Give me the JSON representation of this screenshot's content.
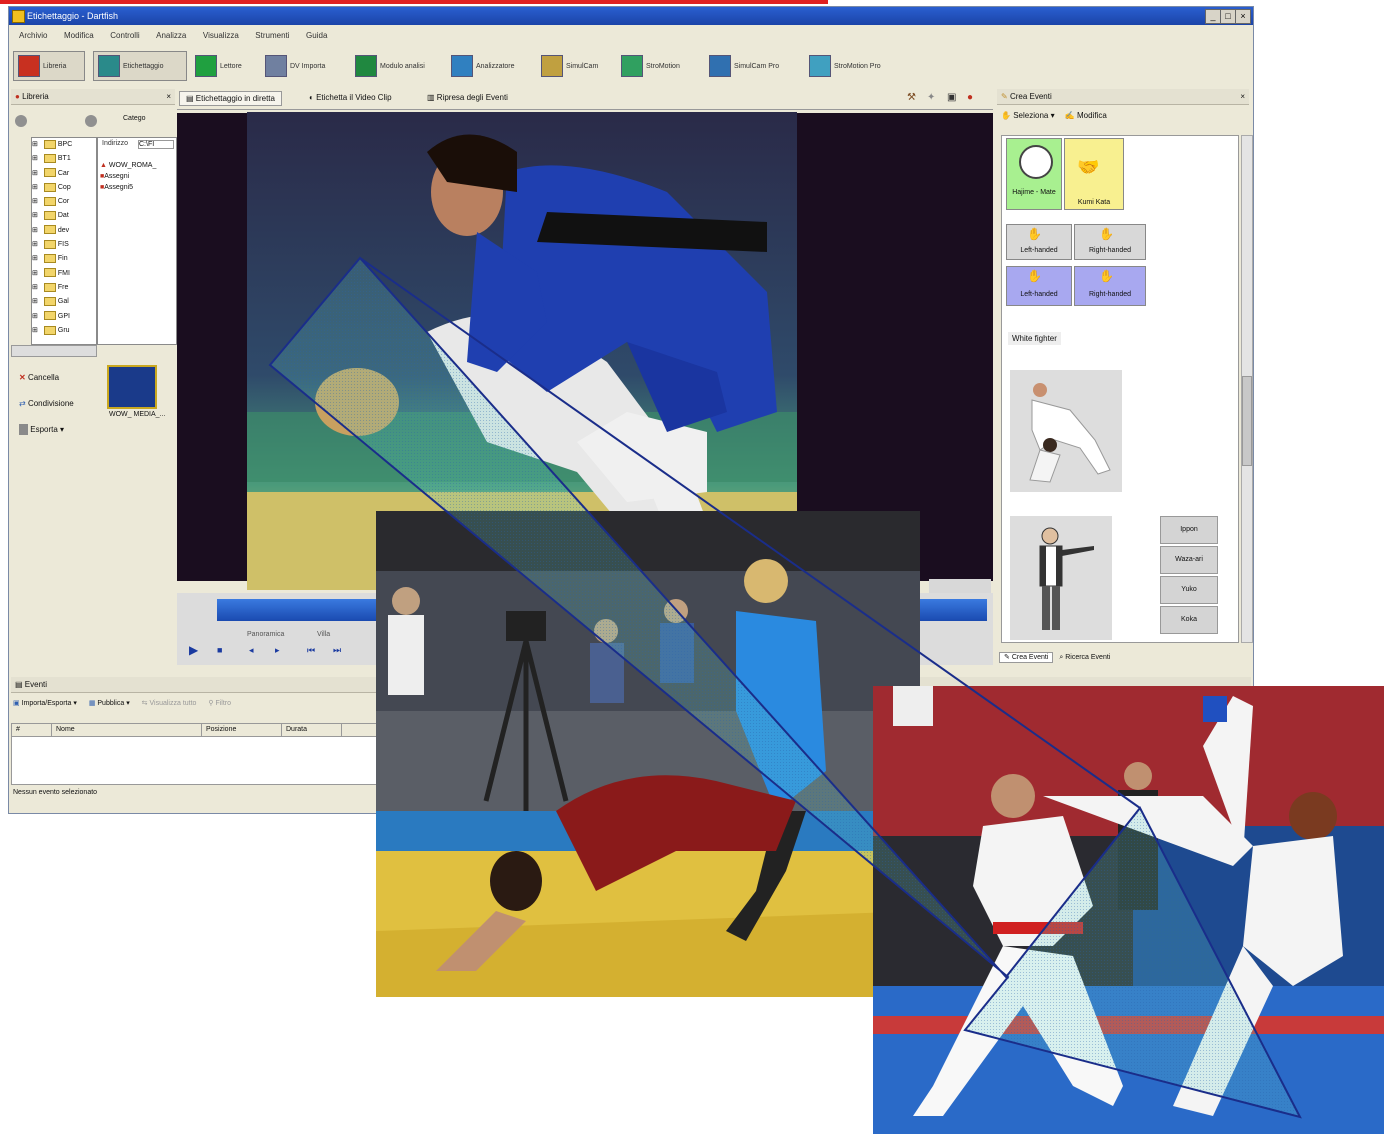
{
  "app": {
    "window_title": "Etichettaggio - Dartfish",
    "window_buttons": [
      "_",
      "□",
      "×"
    ]
  },
  "menu": [
    "Archivio",
    "Modifica",
    "Controlli",
    "Analizza",
    "Visualizza",
    "Strumenti",
    "Guida"
  ],
  "toolbar": [
    {
      "label": "Libreria",
      "icon": "library-icon",
      "color": "#c83020"
    },
    {
      "label": "Etichettaggio",
      "icon": "tagging-icon",
      "color": "#2a8a8a"
    },
    {
      "label": "Lettore",
      "icon": "player-icon",
      "color": "#20a040"
    },
    {
      "label": "DV Importa",
      "icon": "dv-import-icon",
      "color": "#7080a0"
    },
    {
      "label": "Modulo analisi",
      "icon": "analysis-icon",
      "color": "#208840"
    },
    {
      "label": "Analizzatore",
      "icon": "analyzer-icon",
      "color": "#3080c0"
    },
    {
      "label": "SimulCam",
      "icon": "simulcam-icon",
      "color": "#c0a040"
    },
    {
      "label": "StroMotion",
      "icon": "stromotion-icon",
      "color": "#30a060"
    },
    {
      "label": "SimulCam Pro",
      "icon": "simulcam-pro-icon",
      "color": "#3070b0"
    },
    {
      "label": "StroMotion Pro",
      "icon": "stromotion-pro-icon",
      "color": "#40a0c0"
    }
  ],
  "library_panel": {
    "title": "Libreria",
    "category_label": "Catego",
    "address_label": "Indirizzo",
    "address_value": "C:\\FI",
    "tree_items": [
      "BPC",
      "BT1",
      "Car",
      "Cop",
      "Cor",
      "Dat",
      "dev",
      "FIS",
      "Fin",
      "FMI",
      "Fre",
      "Gal",
      "GPI",
      "Gru"
    ],
    "files": [
      "WOW_ROMA_",
      "Assegni",
      "Assegni5"
    ],
    "actions": [
      "Cancella",
      "Condivisione",
      "Esporta"
    ],
    "thumb_caption": "WOW_ MEDIA_..."
  },
  "center_tabs": [
    "Etichettaggio in diretta",
    "Etichetta il Video Clip",
    "Ripresa degli Eventi"
  ],
  "player": {
    "labels": [
      "Panoramica",
      "Villa"
    ]
  },
  "event_panel": {
    "title": "Crea Eventi",
    "select_label": "Seleziona",
    "modify_label": "Modifica",
    "categories": [
      {
        "label": "Hajime - Mate",
        "color": "#a8f090"
      },
      {
        "label": "Kumi Kata",
        "color": "#f8f090"
      },
      {
        "label": "Left-handed",
        "color": "#d8d8d8"
      },
      {
        "label": "Right-handed",
        "color": "#d8d8d8"
      },
      {
        "label": "Left-handed",
        "color": "#a8a8f0"
      },
      {
        "label": "Right-handed",
        "color": "#a8a8f0"
      }
    ],
    "white_fighter_label": "White fighter",
    "score_buttons": [
      "Ippon",
      "Waza-ari",
      "Yuko",
      "Koka"
    ],
    "bottom_tabs": [
      "Crea Eventi",
      "Ricerca Eventi"
    ]
  },
  "events_pane": {
    "title": "Eventi",
    "toolbar": [
      "Importa/Esporta",
      "Pubblica",
      "Visualizza tutto",
      "Filtro"
    ],
    "columns": [
      "#",
      "Nome",
      "Posizione",
      "Durata"
    ],
    "status": "Nessun evento selezionato"
  },
  "colors": {
    "overlay_outline": "#1a2d8a",
    "top_rule": "#e02020"
  }
}
